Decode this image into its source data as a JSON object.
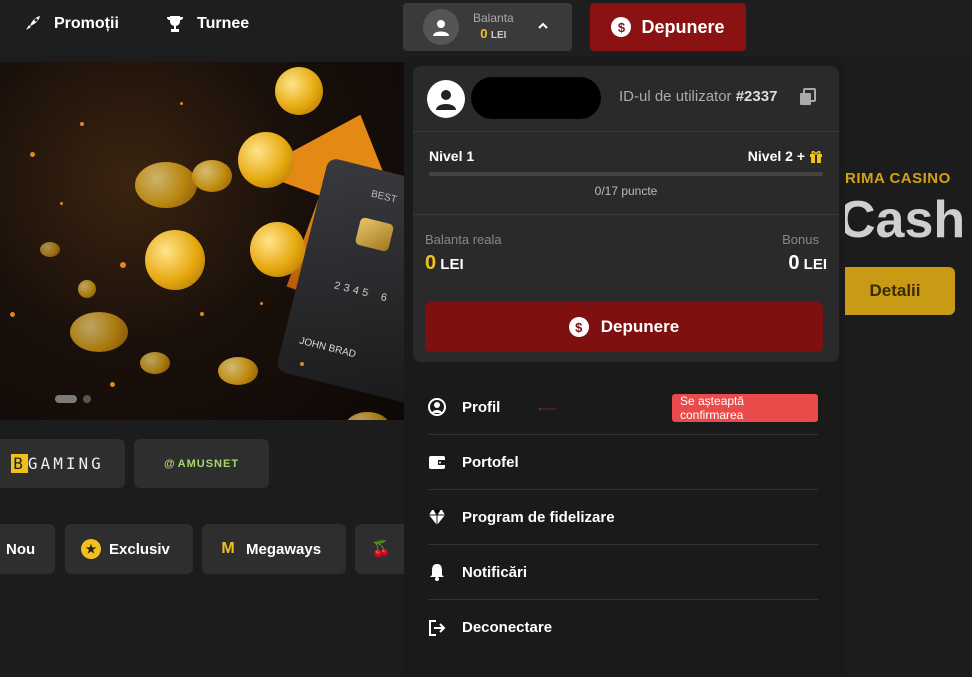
{
  "topbar": {
    "promotions_label": "Promoții",
    "tournaments_label": "Turnee",
    "balance": {
      "label": "Balanta",
      "amount": "0",
      "currency": "LEI"
    },
    "deposit_label": "Depunere"
  },
  "hero": {
    "card": {
      "brand": "BEST",
      "numbers": "2345 6",
      "holder": "JOHN BRAD"
    },
    "side_subtitle": "RIMA CASINO",
    "side_title": "Cash",
    "details_label": "Detalii"
  },
  "providers": [
    {
      "rest": "GAMING",
      "first": "B"
    },
    {
      "label": "AMUSNET"
    }
  ],
  "categories": [
    {
      "label": "Nou"
    },
    {
      "label": "Exclusiv",
      "icon": "star-icon"
    },
    {
      "label": "Megaways",
      "icon": "megaways-icon"
    },
    {
      "label": "",
      "icon": "cherry-icon"
    }
  ],
  "account_menu": {
    "user_id_label": "ID-ul de utilizator",
    "user_id": "#2337",
    "level_current": "Nivel 1",
    "level_next": "Nivel 2 +",
    "points": "0/17 puncte",
    "progress_fraction": 0,
    "real_balance_label": "Balanta reala",
    "real_balance_amount": "0",
    "real_balance_currency": "LEI",
    "bonus_label": "Bonus",
    "bonus_amount": "0",
    "bonus_currency": "LEI",
    "deposit_label": "Depunere",
    "items": [
      {
        "label": "Profil",
        "icon": "user-circle-icon"
      },
      {
        "label": "Portofel",
        "icon": "wallet-icon"
      },
      {
        "label": "Program de fidelizare",
        "icon": "diamond-icon"
      },
      {
        "label": "Notificări",
        "icon": "bell-icon"
      },
      {
        "label": "Deconectare",
        "icon": "logout-icon"
      }
    ],
    "pending_badge": "Se așteaptă confirmarea"
  },
  "colors": {
    "accent_gold": "#f2c01e",
    "deposit_red": "#8a1212",
    "badge_red": "#e94b4b"
  }
}
